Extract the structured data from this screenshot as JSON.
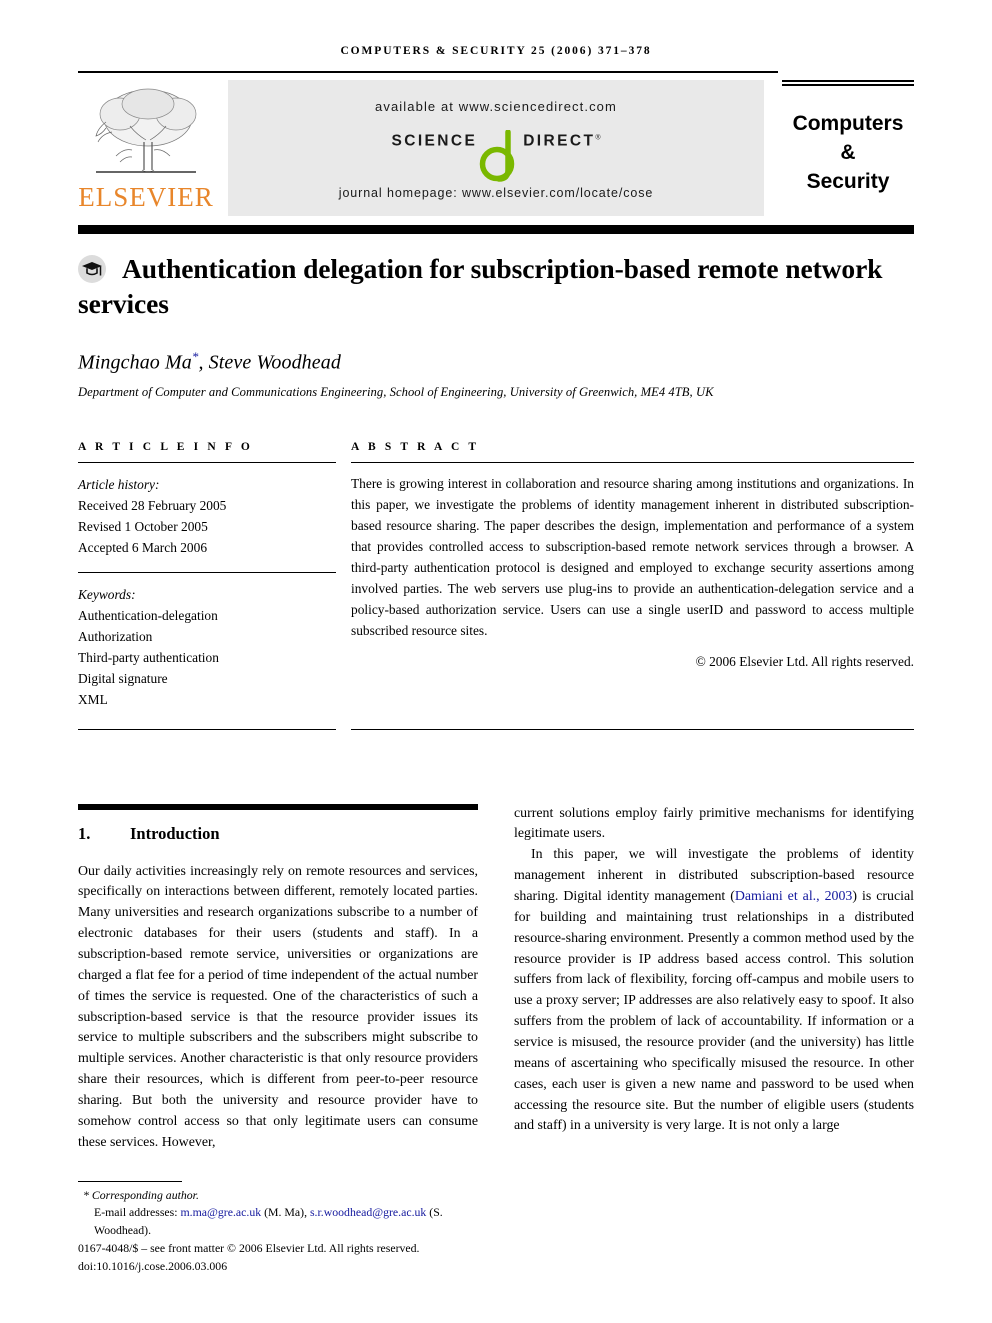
{
  "running_head": "COMPUTERS & SECURITY 25 (2006) 371–378",
  "masthead": {
    "publisher_name": "ELSEVIER",
    "publisher_logo_icon": "elsevier-tree-logo",
    "sciencedirect": {
      "available_at": "available at www.sciencedirect.com",
      "logo_science": "SCIENCE",
      "logo_d": "d",
      "logo_direct": "DIRECT",
      "registered_mark": "®",
      "journal_homepage": "journal homepage: www.elsevier.com/locate/cose"
    },
    "journal_title_lines": [
      "Computers",
      "&",
      "Security"
    ]
  },
  "article": {
    "title": "Authentication delegation for subscription-based remote network services",
    "title_icon": "graduation-cap-icon",
    "authors": "Mingchao Ma",
    "authors_marker": "*",
    "authors_rest": ", Steve Woodhead",
    "affiliation": "Department of Computer and Communications Engineering, School of Engineering, University of Greenwich, ME4 4TB, UK"
  },
  "article_info": {
    "heading": "A R T I C L E    I N F O",
    "history_label": "Article history:",
    "history": [
      "Received 28 February 2005",
      "Revised 1 October 2005",
      "Accepted 6 March 2006"
    ],
    "keywords_label": "Keywords:",
    "keywords": [
      "Authentication-delegation",
      "Authorization",
      "Third-party authentication",
      "Digital signature",
      "XML"
    ]
  },
  "abstract": {
    "heading": "A B S T R A C T",
    "text": "There is growing interest in collaboration and resource sharing among institutions and organizations. In this paper, we investigate the problems of identity management inherent in distributed subscription-based resource sharing. The paper describes the design, implementation and performance of a system that provides controlled access to subscription-based remote network services through a browser. A third-party authentication protocol is designed and employed to exchange security assertions among involved parties. The web servers use plug-ins to provide an authentication-delegation service and a policy-based authorization service. Users can use a single userID and password to access multiple subscribed resource sites.",
    "copyright": "© 2006 Elsevier Ltd. All rights reserved."
  },
  "body": {
    "section_number": "1.",
    "section_title": "Introduction",
    "left_paragraphs": [
      "Our daily activities increasingly rely on remote resources and services, specifically on interactions between different, remotely located parties. Many universities and research organizations subscribe to a number of electronic databases for their users (students and staff). In a subscription-based remote service, universities or organizations are charged a flat fee for a period of time independent of the actual number of times the service is requested. One of the characteristics of such a subscription-based service is that the resource provider issues its service to multiple subscribers and the subscribers might subscribe to multiple services. Another characteristic is that only resource providers share their resources, which is different from peer-to-peer resource sharing. But both the university and resource provider have to somehow control access so that only legitimate users can consume these services. However,"
    ],
    "right_paragraph_continued": "current solutions employ fairly primitive mechanisms for identifying legitimate users.",
    "right_paragraph_2_pre": "In this paper, we will investigate the problems of identity management inherent in distributed subscription-based resource sharing. Digital identity management (",
    "right_citation": "Damiani et al., 2003",
    "right_paragraph_2_post": ") is crucial for building and maintaining trust relationships in a distributed resource-sharing environment. Presently a common method used by the resource provider is IP address based access control. This solution suffers from lack of flexibility, forcing off-campus and mobile users to use a proxy server; IP addresses are also relatively easy to spoof. It also suffers from the problem of lack of accountability. If information or a service is misused, the resource provider (and the university) has little means of ascertaining who specifically misused the resource. In other cases, each user is given a new name and password to be used when accessing the resource site. But the number of eligible users (students and staff) in a university is very large. It is not only a large"
  },
  "footer": {
    "corresponding_author": "* Corresponding author.",
    "email_label": "E-mail addresses:",
    "email_1": "m.ma@gre.ac.uk",
    "email_1_owner": "(M. Ma),",
    "email_2": "s.r.woodhead@gre.ac.uk",
    "email_2_owner": "(S. Woodhead).",
    "issn_line": "0167-4048/$ – see front matter © 2006 Elsevier Ltd. All rights reserved.",
    "doi_line": "doi:10.1016/j.cose.2006.03.006"
  },
  "colors": {
    "elsevier_orange": "#E8862B",
    "sciencedirect_green": "#7AB800",
    "link_blue": "#14199e",
    "banner_gray": "#e9e9e9"
  }
}
